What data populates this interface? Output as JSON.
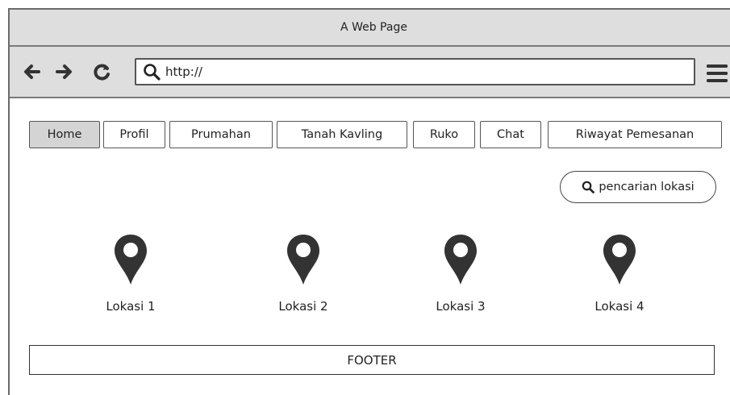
{
  "window": {
    "title": "A Web Page"
  },
  "browser": {
    "url": "http://",
    "back_icon": "arrow-left-icon",
    "forward_icon": "arrow-right-icon",
    "reload_icon": "reload-icon",
    "menu_icon": "hamburger-menu-icon"
  },
  "nav": {
    "items": [
      {
        "label": "Home",
        "active": true
      },
      {
        "label": "Profil"
      },
      {
        "label": "Prumahan"
      },
      {
        "label": "Tanah Kavling"
      },
      {
        "label": "Ruko"
      },
      {
        "label": "Chat"
      },
      {
        "label": "Riwayat Pemesanan"
      }
    ]
  },
  "search": {
    "label": "pencarian lokasi",
    "icon": "search-icon"
  },
  "locations": [
    {
      "label": "Lokasi 1",
      "icon": "map-pin-icon"
    },
    {
      "label": "Lokasi 2",
      "icon": "map-pin-icon"
    },
    {
      "label": "Lokasi 3",
      "icon": "map-pin-icon"
    },
    {
      "label": "Lokasi 4",
      "icon": "map-pin-icon"
    }
  ],
  "footer": {
    "label": "FOOTER"
  },
  "colors": {
    "chrome": "#dedede",
    "active_tab": "#d4d4d4",
    "icon": "#333333"
  }
}
